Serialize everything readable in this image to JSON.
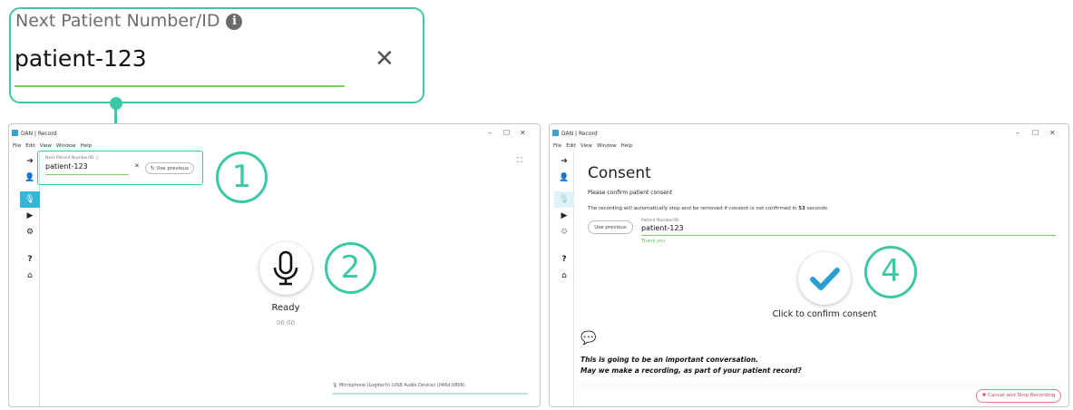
{
  "zoom": {
    "label": "Next Patient Number/ID",
    "info_glyph": "i",
    "value": "patient-123",
    "clear_glyph": "✕"
  },
  "left_window": {
    "title": "DAN | Record",
    "menu": [
      "File",
      "Edit",
      "View",
      "Window",
      "Help"
    ],
    "patient_label": "Next Patient Number/ID",
    "patient_value": "patient-123",
    "clear_glyph": "✕",
    "use_previous": "Use previous",
    "status": "Ready",
    "timer": "00:00",
    "mic_device": "Microphone (Logitech) (USB Audio Device) (046d:0809)",
    "step_1": "1",
    "step_2": "2"
  },
  "right_window": {
    "title": "DAN | Record",
    "menu": [
      "File",
      "Edit",
      "View",
      "Window",
      "Help"
    ],
    "heading": "Consent",
    "subheading": "Please confirm patient consent",
    "notice_prefix": "The recording will automatically stop and be removed if consent is not confirmed in ",
    "notice_seconds": "53",
    "notice_suffix": " seconds.",
    "use_previous": "Use previous",
    "patient_label": "Patient Number/ID",
    "patient_value": "patient-123",
    "thank_you": "Thank you",
    "confirm_label": "Click to confirm consent",
    "script_line_1": "This is going to be an important conversation.",
    "script_line_2": "May we make a recording, as part of your patient record?",
    "cancel_label": "✖ Cancel and Stop Recording",
    "step_4": "4"
  },
  "colors": {
    "accent": "#3cc8a6",
    "sidebar_active": "#33b6d8",
    "check_blue": "#2a9fd6",
    "field_underline": "#7ccf6b",
    "cancel_red": "#d3455c"
  }
}
